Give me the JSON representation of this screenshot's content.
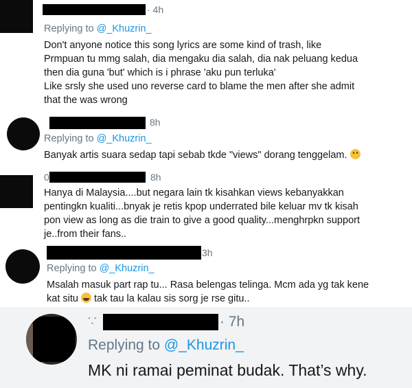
{
  "replies": [
    {
      "time": "· 4h",
      "replying_prefix": "Replying to ",
      "replying_handle": "@_Khuzrin_",
      "lines": [
        "Don't anyone notice this song lyrics are some kind of trash, like",
        "Prmpuan tu mmg salah, dia mengaku dia salah, dia nak peluang kedua",
        "then dia guna 'but' which is i phrase 'aku pun terluka'",
        "Like srsly she used uno reverse card to blame the men after she admit",
        "that the was wrong"
      ]
    },
    {
      "time": "8h",
      "replying_prefix": "Replying to ",
      "replying_handle": "@_Khuzrin_",
      "lines": [
        "Banyak artis suara sedap tapi sebab tkde \"views\" dorang tenggelam."
      ],
      "emoji": "sad-face-emoji"
    },
    {
      "name_lead": "0",
      "time": "8h",
      "lines": [
        "Hanya di Malaysia....but negara lain tk kisahkan views kebanyakkan",
        "pentingkn kualiti...bnyak je retis kpop underrated bile keluar mv tk kisah",
        "pon view as long as die train to give a good quality...menghrpkn support",
        "je..from their fans.."
      ]
    },
    {
      "time": "3h",
      "replying_prefix": "Replying to ",
      "replying_handle": "@_Khuzrin_",
      "lines": [
        "Msalah masuk part rap tu... Rasa belengas telinga. Mcm ada yg tak kene",
        "tak tau la kalau sis sorg je rse gitu.."
      ],
      "line2_prefix": "kat situ",
      "emoji": "laughing-emoji"
    },
    {
      "time": "· 7h",
      "replying_prefix": "Replying to ",
      "replying_handle": "@_Khuzrin_",
      "lines": [
        "MK ni ramai peminat budak. That’s why."
      ]
    }
  ],
  "colors": {
    "link": "#1b95e0",
    "meta": "#657786",
    "text": "#14171a",
    "zoom_bg": "#f1f3f5"
  }
}
